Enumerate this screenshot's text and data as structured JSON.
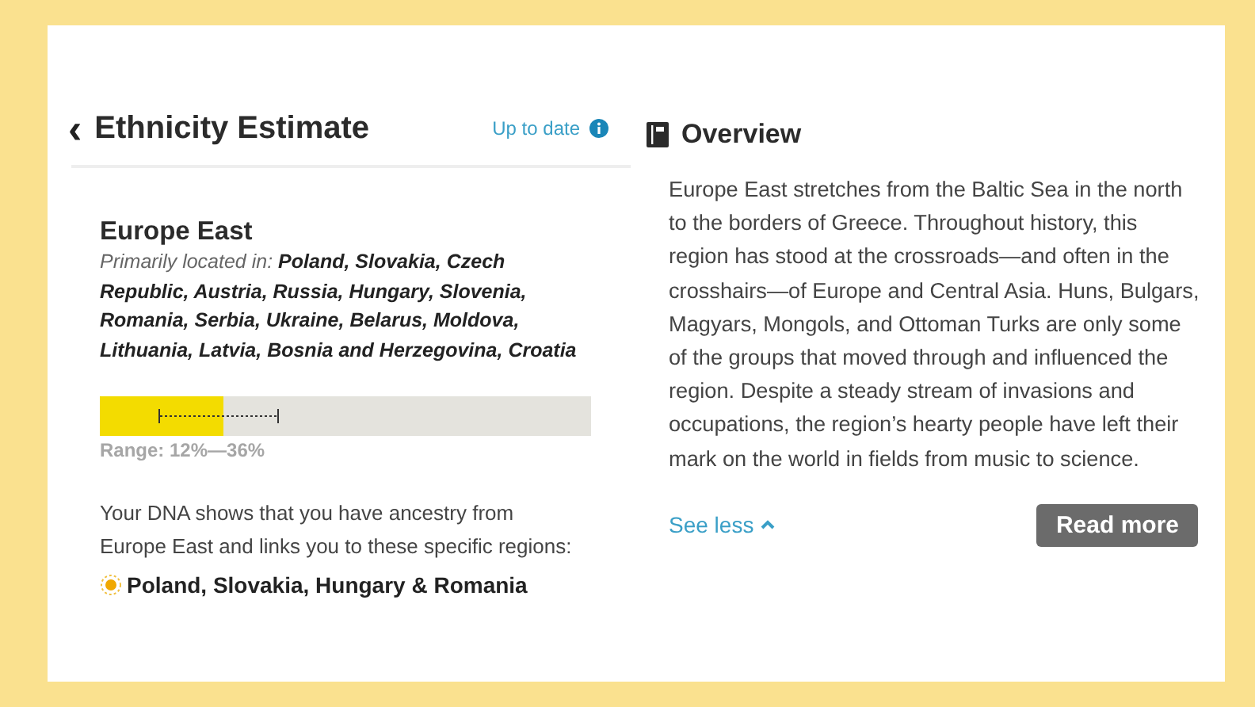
{
  "header": {
    "back": "‹",
    "title": "Ethnicity Estimate",
    "status": "Up to date"
  },
  "region": {
    "name": "Europe East",
    "located": "Primarily located in: **Poland, Slovakia, Czech Republic, Austria, Russia, Hungary, Slovenia, Romania, Serbia, Ukraine, Belarus, Moldova, Lithuania, Latvia, Bosnia and Herzegovina, Croatia**",
    "level": 0.25,
    "range": "Range: 12%—36%",
    "ancestry": "Your DNA shows that you have ancestry from Europe East and links you to these specific regions:",
    "subregion": "Poland, Slovakia, Hungary & Romania"
  },
  "overview": {
    "title": "Overview",
    "text": "Europe East stretches from the Baltic Sea in the north to the borders of Greece. Throughout history, this region has stood at the crossroads—and often in the crosshairs—of Europe and Central Asia. Huns, Bulgars, Magyars, Mongols, and Ottoman Turks are only some of the groups that moved through and influenced the region. Despite a steady stream of invasions and occupations, the region’s hearty people have left their mark on the world in fields from music to science.",
    "see_less": "See less",
    "read_more": "Read more"
  }
}
